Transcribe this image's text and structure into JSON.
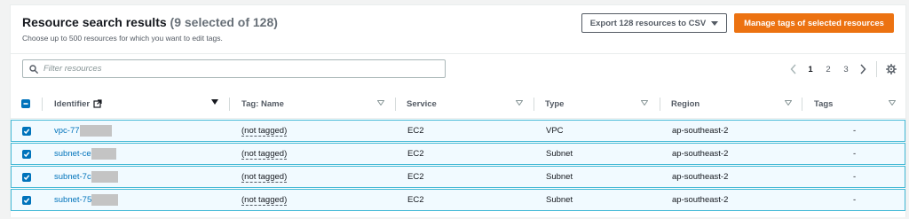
{
  "header": {
    "title": "Resource search results",
    "selection_count": "(9 selected of 128)",
    "subtitle": "Choose up to 500 resources for which you want to edit tags."
  },
  "buttons": {
    "export_label": "Export 128 resources to CSV",
    "manage_label": "Manage tags of selected resources"
  },
  "filter": {
    "placeholder": "Filter resources",
    "value": ""
  },
  "pagination": {
    "pages": [
      "1",
      "2",
      "3"
    ],
    "current": "1"
  },
  "columns": {
    "identifier": "Identifier",
    "tag_name": "Tag: Name",
    "service": "Service",
    "type": "Type",
    "region": "Region",
    "tags": "Tags"
  },
  "rows": [
    {
      "checked": true,
      "identifier": "vpc-77",
      "tag_name": "(not tagged)",
      "service": "EC2",
      "type": "VPC",
      "region": "ap-southeast-2",
      "tags": "-"
    },
    {
      "checked": true,
      "identifier": "subnet-ce",
      "tag_name": "(not tagged)",
      "service": "EC2",
      "type": "Subnet",
      "region": "ap-southeast-2",
      "tags": "-"
    },
    {
      "checked": true,
      "identifier": "subnet-7c",
      "tag_name": "(not tagged)",
      "service": "EC2",
      "type": "Subnet",
      "region": "ap-southeast-2",
      "tags": "-"
    },
    {
      "checked": true,
      "identifier": "subnet-75",
      "tag_name": "(not tagged)",
      "service": "EC2",
      "type": "Subnet",
      "region": "ap-southeast-2",
      "tags": "-"
    }
  ],
  "colors": {
    "accent": "#ec7211",
    "link": "#0073bb",
    "selected_row_bg": "#f1faff",
    "selected_row_border": "#44b9d6"
  },
  "icons": {
    "filter": "search-icon",
    "external": "external-link-icon",
    "settings": "gear-icon",
    "prev": "chevron-left-icon",
    "next": "chevron-right-icon"
  }
}
